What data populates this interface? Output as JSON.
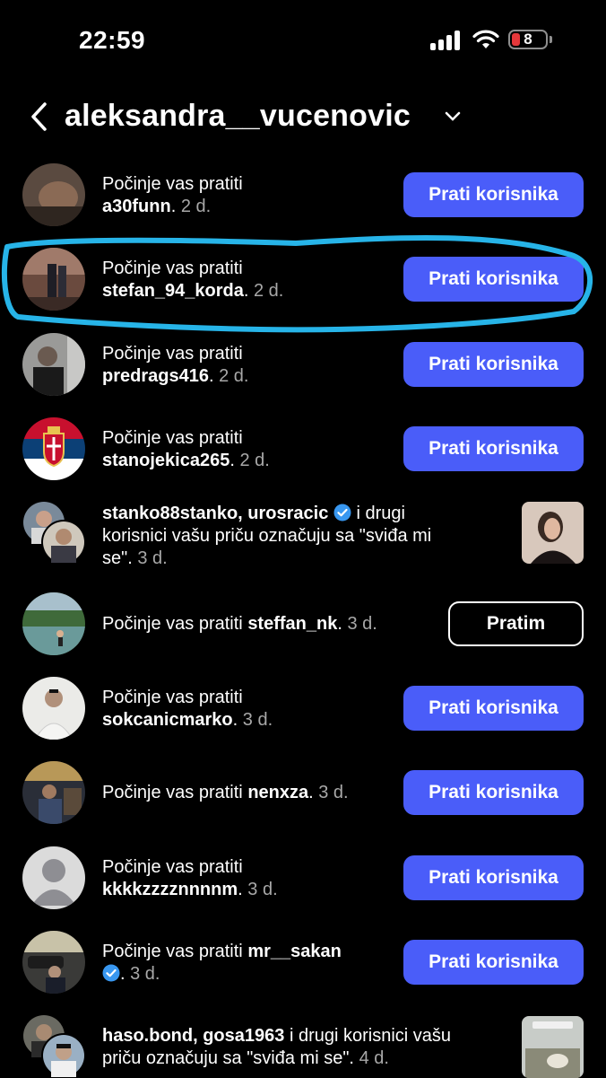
{
  "status_bar": {
    "time": "22:59",
    "battery": "8"
  },
  "header": {
    "title": "aleksandra__vucenovic"
  },
  "colors": {
    "accent": "#4a5df9",
    "highlight": "#27b4e8",
    "verified": "#3897f0"
  },
  "rows": [
    {
      "line1": "Počinje vas pratiti",
      "username": "a30funn",
      "time": "2 d.",
      "button": "Prati korisnika"
    },
    {
      "line1": "Počinje vas pratiti",
      "username": "stefan_94_korda",
      "time": "2 d.",
      "button": "Prati korisnika"
    },
    {
      "line1": "Počinje vas pratiti",
      "username": "predrags416",
      "time": "2 d.",
      "button": "Prati korisnika"
    },
    {
      "line1": "Počinje vas pratiti",
      "username": "stanojekica265",
      "time": "2 d.",
      "button": "Prati korisnika"
    },
    {
      "users": "stanko88stanko, urosracic",
      "rest": " i drugi",
      "line2": "korisnici vašu priču označuju sa \"sviđa mi",
      "line3": "se\".",
      "time": "3 d."
    },
    {
      "line1": "Počinje vas pratiti",
      "username": "steffan_nk",
      "time": "3 d.",
      "button": "Pratim"
    },
    {
      "line1": "Počinje vas pratiti",
      "username": "sokcanicmarko",
      "time": "3 d.",
      "button": "Prati korisnika"
    },
    {
      "line1": "Počinje vas pratiti",
      "username": "nenxza",
      "time": "3 d.",
      "button": "Prati korisnika"
    },
    {
      "line1": "Počinje vas pratiti",
      "username": "kkkkzzzznnnnm",
      "time": "3 d.",
      "button": "Prati korisnika"
    },
    {
      "line1": "Počinje vas pratiti",
      "username": "mr__sakan",
      "time": "3 d.",
      "button": "Prati korisnika"
    },
    {
      "users": "haso.bond, gosa1963",
      "rest": " i drugi korisnici vašu",
      "line2": "priču označuju sa \"sviđa mi se\".",
      "time": "4 d."
    }
  ]
}
